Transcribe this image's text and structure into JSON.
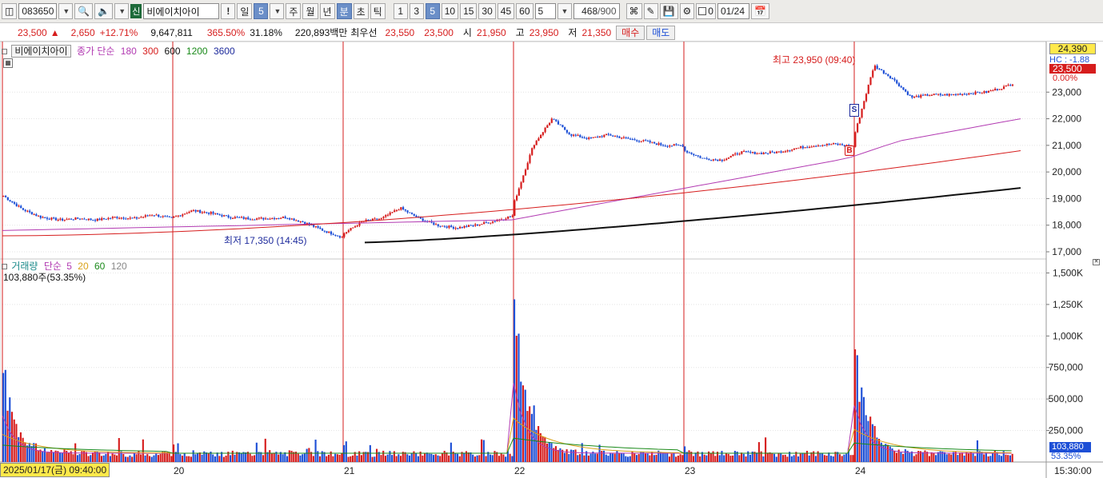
{
  "toolbar": {
    "code": "083650",
    "stock_name": "비에이치아이",
    "shin_label": "신",
    "alert_label": "!",
    "periods": [
      "일",
      "주",
      "월",
      "년",
      "분",
      "초",
      "틱"
    ],
    "active_period": "분",
    "day_count": "5",
    "minute_options": [
      "1",
      "3",
      "5",
      "10",
      "15",
      "30",
      "45",
      "60"
    ],
    "active_minute": "5",
    "count_value": "5",
    "display_count": "468",
    "display_total": "/900",
    "date_value": "01/24",
    "checkbox_label": "0"
  },
  "info": {
    "price": "23,500",
    "change_arrow": "▲",
    "change": "2,650",
    "change_pct": "+12.71%",
    "volume": "9,647,811",
    "vol_ratio": "365.50%",
    "turnover": "31.18%",
    "amount": "220,893백만",
    "best_label": "최우선",
    "best_ask": "23,550",
    "best_bid": "23,500",
    "open_label": "시",
    "open": "21,950",
    "high_label": "고",
    "high": "23,950",
    "low_label": "저",
    "low": "21,350",
    "buy_label": "매수",
    "sell_label": "매도"
  },
  "price_legend": {
    "name": "비에이치아이",
    "indicator": "종가 단순",
    "ma": [
      "180",
      "300",
      "600",
      "1200",
      "3600"
    ],
    "ma_colors": [
      "#b23ab2",
      "#d61d1d",
      "#111111",
      "#1a8a1a",
      "#1d2a9c"
    ]
  },
  "volume_legend": {
    "name": "거래량",
    "indicator": "단순",
    "ma": [
      "5",
      "20",
      "60",
      "120"
    ],
    "ma_colors": [
      "#b23ab2",
      "#d9a21a",
      "#1a8a1a",
      "#888888"
    ],
    "value": "103,880주(53.35%)"
  },
  "annotations": {
    "high": "최고 23,950 (09:40)",
    "low": "최저 17,350 (14:45)",
    "s_marker": "S",
    "b_marker": "B"
  },
  "right_labels": {
    "top_price": "24,390",
    "current_price": "23,500",
    "current_pct": "0.00%",
    "hc": "HC : -1.88",
    "vol_current": "103,880",
    "vol_pct": "53.35%",
    "end_time": "15:30:00"
  },
  "x_axis": {
    "cursor_label": "2025/01/17(금) 09:40:00",
    "day_labels": [
      "20",
      "21",
      "22",
      "23",
      "24"
    ]
  },
  "chart_data": {
    "type": "line",
    "y_price_ticks": [
      "23,000",
      "22,000",
      "21,000",
      "20,000",
      "19,000",
      "18,000",
      "17,000"
    ],
    "y_price_values": [
      23000,
      22000,
      21000,
      20000,
      19000,
      18000,
      17000
    ],
    "y_volume_ticks": [
      "1,500K",
      "1,250K",
      "1,000K",
      "750,000",
      "500,000",
      "250,000"
    ],
    "y_volume_values": [
      1500000,
      1250000,
      1000000,
      750000,
      500000,
      250000
    ],
    "price_ylim": [
      16850,
      24600
    ],
    "volume_ylim": [
      0,
      1560000
    ],
    "days": [
      "01/17",
      "01/20",
      "01/21",
      "01/22",
      "01/23",
      "01/24"
    ],
    "price_close_by_day": [
      [
        19100,
        18600,
        18300,
        18200,
        18250,
        18200,
        18300,
        18250,
        18400,
        18250
      ],
      [
        18300,
        18550,
        18450,
        18300,
        18250,
        18250,
        18300,
        18100,
        17800,
        17550
      ],
      [
        17700,
        18150,
        18250,
        18650,
        18250,
        18000,
        17900,
        18000,
        18150,
        18350
      ],
      [
        18900,
        21000,
        22000,
        21400,
        21250,
        21400,
        21250,
        21150,
        21000,
        21000
      ],
      [
        20800,
        20500,
        20450,
        20750,
        20700,
        20750,
        20900,
        21000,
        21050,
        20950
      ],
      [
        21500,
        24000,
        23500,
        22800,
        22900,
        22900,
        22950,
        23000,
        23200,
        23500
      ]
    ],
    "series": [
      {
        "name": "180",
        "values_start": 17800,
        "values_end": 21700
      },
      {
        "name": "300",
        "values_start": 17600,
        "values_end": 20800
      },
      {
        "name": "600",
        "values_start": 17350,
        "values_end": 19400
      }
    ],
    "volume_peaks": [
      {
        "day": "01/17",
        "max": 770000
      },
      {
        "day": "01/22",
        "max": 1440000
      },
      {
        "day": "01/24",
        "max": 980000
      }
    ]
  }
}
